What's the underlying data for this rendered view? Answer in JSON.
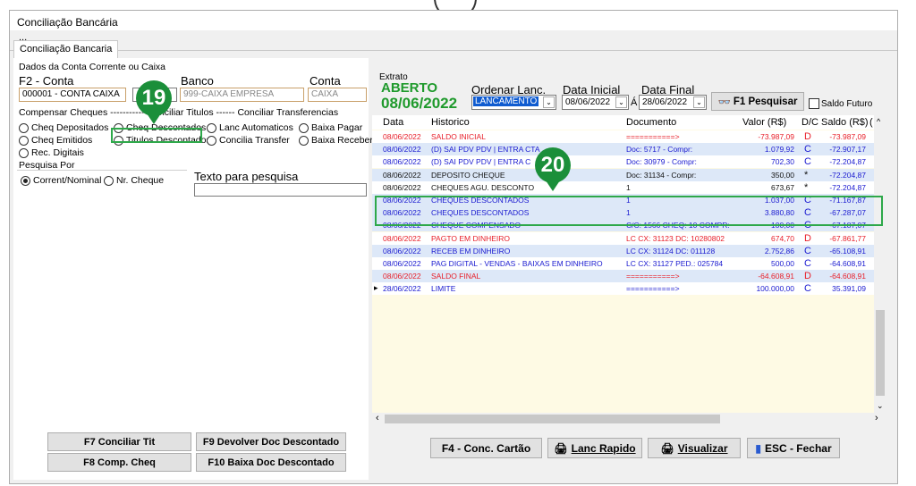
{
  "window": {
    "title": "Conciliação Bancária",
    "subtitle": "..."
  },
  "tabs": [
    {
      "label": "Conciliação Bancaria"
    }
  ],
  "left": {
    "account_group": "Dados da Conta Corrente ou Caixa",
    "f2_label": "F2 - Conta",
    "account_value": "000001 - CONTA CAIXA",
    "bank_label": "Banco",
    "bank_value": "999-CAIXA EMPRESA",
    "conta_label": "Conta",
    "conta_value": "CAIXA",
    "compensar_header": "Compensar Cheques ----------- Conciliar Titulos ------ Conciliar Transferencias",
    "radios": [
      {
        "label": "Cheq Depositados",
        "selected": false
      },
      {
        "label": "Cheq Descontados",
        "selected": false
      },
      {
        "label": "Lanc Automaticos",
        "selected": false
      },
      {
        "label": "Baixa Pagar",
        "selected": false
      },
      {
        "label": "Cheq Emitidos",
        "selected": false
      },
      {
        "label": "Titulos Descontados",
        "selected": false
      },
      {
        "label": "Concilia Transfer",
        "selected": false
      },
      {
        "label": "Baixa Receber",
        "selected": false
      },
      {
        "label": "Rec. Digitais",
        "selected": false
      }
    ],
    "pesquisa_label": "Pesquisa Por",
    "pesquisa_options": [
      {
        "label": "Corrent/Nominal",
        "selected": true
      },
      {
        "label": "Nr. Cheque",
        "selected": false
      }
    ],
    "texto_label": "Texto para pesquisa",
    "texto_value": "",
    "buttons": [
      "F7 Conciliar Tit",
      "F9 Devolver Doc Descontado",
      "F8 Comp. Cheq",
      "F10 Baixa Doc Descontado"
    ]
  },
  "right": {
    "extrato_label": "Extrato",
    "status": "ABERTO",
    "status_date": "08/06/2022",
    "ordenar_label": "Ordenar Lanc.",
    "ordenar_value": "LANCAMENTO",
    "data_inicial_label": "Data Inicial",
    "data_inicial_value": "08/06/2022",
    "a_label": "Á",
    "data_final_label": "Data Final",
    "data_final_value": "28/06/2022",
    "pesquisar_label": "F1 Pesquisar",
    "saldo_futuro_label": "Saldo Futuro",
    "columns": [
      "Data",
      "Historico",
      "Documento",
      "Valor (R$)",
      "D/C",
      "Saldo (R$)",
      "("
    ],
    "rows": [
      {
        "data": "08/06/2022",
        "hist": "SALDO INICIAL",
        "doc": "===========>",
        "valor": "-73.987,09",
        "dc": "D",
        "saldo": "-73.987,09",
        "color": "red"
      },
      {
        "data": "08/06/2022",
        "hist": "(D) SAI PDV PDV | ENTRA CTA",
        "doc": "Doc: 5717 - Compr:",
        "valor": "1.079,92",
        "dc": "C",
        "saldo": "-72.907,17",
        "color": "blue"
      },
      {
        "data": "08/06/2022",
        "hist": "(D) SAI PDV PDV | ENTRA C",
        "doc": "Doc: 30979 - Compr:",
        "valor": "702,30",
        "dc": "C",
        "saldo": "-72.204,87",
        "color": "blue"
      },
      {
        "data": "08/06/2022",
        "hist": "DEPOSITO CHEQUE",
        "doc": "Doc: 31134 - Compr:",
        "valor": "350,00",
        "dc": "*",
        "saldo": "-72.204,87",
        "color": "dk"
      },
      {
        "data": "08/06/2022",
        "hist": "CHEQUES AGU. DESCONTO",
        "doc": "1",
        "valor": "673,67",
        "dc": "*",
        "saldo": "-72.204,87",
        "color": "dk"
      },
      {
        "data": "08/06/2022",
        "hist": "CHEQUES DESCONTADOS",
        "doc": "1",
        "valor": "1.037,00",
        "dc": "C",
        "saldo": "-71.167,87",
        "color": "blue"
      },
      {
        "data": "08/06/2022",
        "hist": "CHEQUES DESCONTADOS",
        "doc": "1",
        "valor": "3.880,80",
        "dc": "C",
        "saldo": "-67.287,07",
        "color": "blue"
      },
      {
        "data": "08/06/2022",
        "hist": "CHEQUE COMPENSADO",
        "doc": "C/C: 1566 CHEQ: 10 COMPR:",
        "valor": "100,00",
        "dc": "C",
        "saldo": "-67.187,07",
        "color": "blue"
      },
      {
        "data": "08/06/2022",
        "hist": "PAGTO EM DINHEIRO",
        "doc": "LC CX: 31123 DC: 10280802",
        "valor": "674,70",
        "dc": "D",
        "saldo": "-67.861,77",
        "color": "red"
      },
      {
        "data": "08/06/2022",
        "hist": "RECEB EM DINHEIRO",
        "doc": "LC CX: 31124 DC: 011128",
        "valor": "2.752,86",
        "dc": "C",
        "saldo": "-65.108,91",
        "color": "blue"
      },
      {
        "data": "08/06/2022",
        "hist": "PAG DIGITAL - VENDAS - BAIXAS EM DINHEIRO",
        "doc": "LC CX: 31127 PED.: 025784",
        "valor": "500,00",
        "dc": "C",
        "saldo": "-64.608,91",
        "color": "blue"
      },
      {
        "data": "08/06/2022",
        "hist": "SALDO FINAL",
        "doc": "===========>",
        "valor": "-64.608,91",
        "dc": "D",
        "saldo": "-64.608,91",
        "color": "red"
      },
      {
        "data": "28/06/2022",
        "hist": "LIMITE",
        "doc": "===========>",
        "valor": "100.000,00",
        "dc": "C",
        "saldo": "35.391,09",
        "color": "blue"
      }
    ],
    "bottom_buttons": [
      "F4 - Conc. Cartão",
      "Lanc Rapido",
      "Visualizar",
      "ESC - Fechar"
    ]
  },
  "annotations": [
    {
      "number": "19"
    },
    {
      "number": "20"
    }
  ],
  "colors": {
    "accent": "#1b8f3a",
    "highlight_border": "#2ea84a",
    "row_alt": "#dde8f8",
    "grid_bg": "#fefae4",
    "status_green": "#1f9a2c"
  }
}
